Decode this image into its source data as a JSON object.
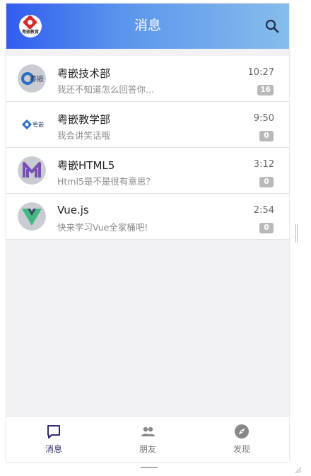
{
  "header": {
    "title": "消息",
    "logo_text": "粤嵌教育",
    "search_icon": "search-icon"
  },
  "chats": [
    {
      "name": "粤嵌技术部",
      "preview": "我还不知道怎么回答你...",
      "time": "10:27",
      "unread": "16",
      "avatar": "yueqian-round-logo"
    },
    {
      "name": "粤嵌教学部",
      "preview": "我会讲笑话哦",
      "time": "9:50",
      "unread": "0",
      "avatar": "yueqian-diamond-logo"
    },
    {
      "name": "粤嵌HTML5",
      "preview": "Html5是不是很有意思？",
      "time": "3:12",
      "unread": "0",
      "avatar": "m-logo"
    },
    {
      "name": "Vue.js",
      "preview": "快来学习Vue全家桶吧!",
      "time": "2:54",
      "unread": "0",
      "avatar": "vue-logo"
    }
  ],
  "avatar_labels": {
    "tech": "粤嵌",
    "teach": "粤嵌"
  },
  "nav": [
    {
      "label": "消息",
      "icon": "chat-bubble-icon",
      "active": true
    },
    {
      "label": "朋友",
      "icon": "people-icon",
      "active": false
    },
    {
      "label": "发现",
      "icon": "compass-icon",
      "active": false
    }
  ],
  "colors": {
    "header_start": "#2f5df0",
    "header_end": "#86bdec",
    "active_nav": "#2e2c6e",
    "badge": "#b9b9b9"
  }
}
